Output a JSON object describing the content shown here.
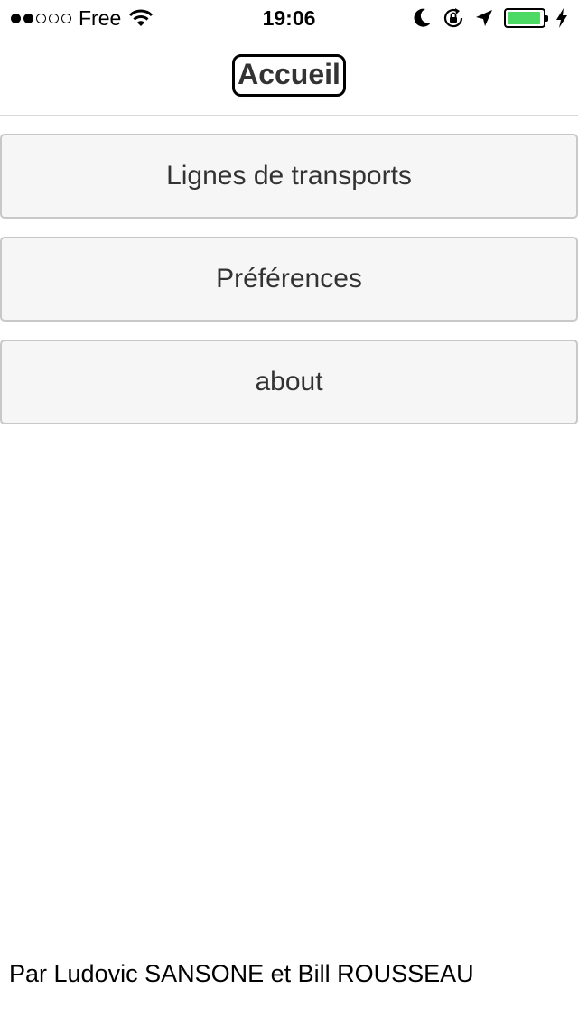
{
  "status_bar": {
    "carrier": "Free",
    "time": "19:06",
    "signal_dots_filled": 2,
    "signal_dots_total": 5,
    "battery_level": 0.95,
    "icons": [
      "wifi-icon",
      "moon-icon",
      "rotation-lock-icon",
      "location-arrow-icon",
      "battery-icon",
      "charging-bolt-icon"
    ],
    "battery_color": "#4cd964"
  },
  "nav": {
    "title": "Accueil"
  },
  "menu": {
    "items": [
      {
        "label": "Lignes de transports"
      },
      {
        "label": "Préférences"
      },
      {
        "label": "about"
      }
    ]
  },
  "footer": {
    "text": "Par Ludovic SANSONE et Bill ROUSSEAU"
  }
}
